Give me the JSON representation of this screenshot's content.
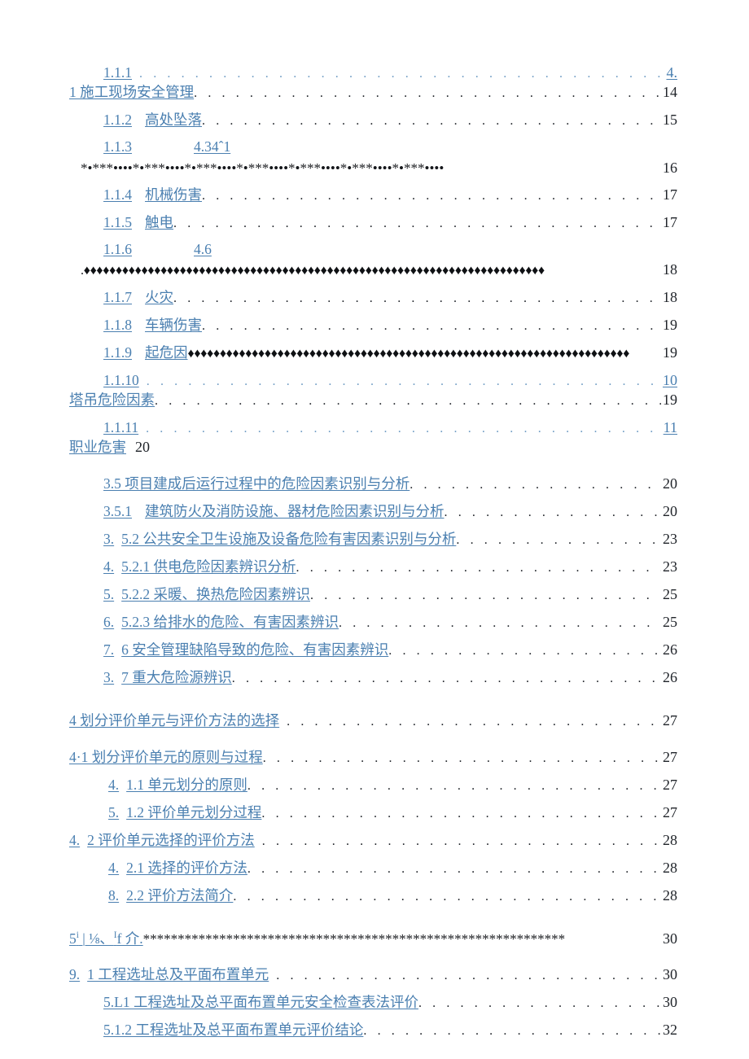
{
  "document": {
    "type": "table-of-contents",
    "language": "zh-CN",
    "page_background": "#ffffff",
    "link_color": "#4a7fb0",
    "text_color": "#20242a"
  },
  "entries": [
    {
      "id": "e1",
      "number": "1.1.1",
      "title": "",
      "page": "4.",
      "page_style": "blue",
      "leader": "dots-blue",
      "indent": 1,
      "wrap": {
        "title": "1 施工现场安全管理",
        "page": "14",
        "leader": "dots-dark",
        "page_style": "plain"
      }
    },
    {
      "id": "e2",
      "number": "1.1.2",
      "title": "高处坠落",
      "page": "15",
      "page_style": "plain",
      "leader": "dots-dark",
      "indent": 1
    },
    {
      "id": "e3",
      "number": "1.1.3",
      "title": "4.34ˆ1",
      "page": "16",
      "page_style": "plain",
      "leader": "none",
      "indent": 1,
      "sub_leader": {
        "text": "*•***••••*•***••••*•***••••*•***••••*•***••••*•***••••*•***••••",
        "page": "16"
      }
    },
    {
      "id": "e4",
      "number": "1.1.4",
      "title": "机械伤害",
      "page": "17",
      "page_style": "plain",
      "leader": "dots-dark",
      "indent": 1
    },
    {
      "id": "e5",
      "number": "1.1.5",
      "title": "触电",
      "page": "17",
      "page_style": "plain",
      "leader": "dots-dark",
      "indent": 1
    },
    {
      "id": "e6",
      "number": "1.1.6",
      "title": "4.6",
      "page": "18",
      "page_style": "plain",
      "leader": "none",
      "indent": 1,
      "sub_leader": {
        "text": ".♦♦♦♦♦♦♦♦♦♦♦♦♦♦♦♦♦♦♦♦♦♦♦♦♦♦♦♦♦♦♦♦♦♦♦♦♦♦♦♦♦♦♦♦♦♦♦♦♦♦♦♦♦♦♦♦♦♦♦♦♦♦♦♦♦♦♦♦♦♦♦♦",
        "page": "18"
      }
    },
    {
      "id": "e7",
      "number": "1.1.7",
      "title": "火灾",
      "page": "18",
      "page_style": "plain",
      "leader": "dots-dark",
      "indent": 1
    },
    {
      "id": "e8",
      "number": "1.1.8",
      "title": "车辆伤害",
      "page": "19",
      "page_style": "plain",
      "leader": "dots-dark",
      "indent": 1
    },
    {
      "id": "e9",
      "number": "1.1.9",
      "title": "起危因",
      "page": "19",
      "page_style": "plain",
      "leader": "diamonds",
      "indent": 1
    },
    {
      "id": "e10",
      "number": "1.1.10",
      "title": "",
      "page": "10",
      "page_style": "blue",
      "leader": "dots-blue",
      "indent": 1,
      "wrap": {
        "title": "塔吊危险因素",
        "page": "19",
        "leader": "dots-dark",
        "page_style": "plain"
      }
    },
    {
      "id": "e11",
      "number": "1.1.11",
      "title": "",
      "page": "11",
      "page_style": "blue",
      "leader": "dots-blue",
      "indent": 1,
      "wrap": {
        "title": "职业危害",
        "page": "20",
        "leader": "none",
        "page_style": "plain"
      }
    },
    {
      "id": "e12",
      "number": "",
      "title": "3.5 项目建成后运行过程中的危险因素识别与分析",
      "page": "20",
      "page_style": "plain",
      "leader": "dots-dark",
      "indent": 1
    },
    {
      "id": "e13",
      "number": "3.5.1",
      "title": "建筑防火及消防设施、器材危险因素识别与分析",
      "page": "20",
      "page_style": "plain",
      "leader": "dots-dark",
      "indent": 1
    },
    {
      "id": "e14",
      "number": "3.",
      "title": "5.2 公共安全卫生设施及设备危险有害因素识别与分析",
      "page": "23",
      "page_style": "plain",
      "leader": "dots-dark",
      "indent": 1
    },
    {
      "id": "e15",
      "number": "4.",
      "title": "5.2.1 供电危险因素辨识分析",
      "page": "23",
      "page_style": "plain",
      "leader": "dots-dark",
      "indent": 1
    },
    {
      "id": "e16",
      "number": "5.",
      "title": "5.2.2 采暖、换热危险因素辨识",
      "page": "25",
      "page_style": "plain",
      "leader": "dots-dark",
      "indent": 1
    },
    {
      "id": "e17",
      "number": "6.",
      "title": "5.2.3 给排水的危险、有害因素辨识",
      "page": "25",
      "page_style": "plain",
      "leader": "dots-dark",
      "indent": 1
    },
    {
      "id": "e18",
      "number": "7.",
      "title": "6 安全管理缺陷导致的危险、有害因素辨识",
      "page": "26",
      "page_style": "plain",
      "leader": "dots-dark",
      "indent": 1
    },
    {
      "id": "e19",
      "number": "3.",
      "title": "7 重大危险源辨识",
      "page": "26",
      "page_style": "plain",
      "leader": "dots-dark",
      "indent": 1
    },
    {
      "id": "e20",
      "number": "",
      "title": "4 划分评价单元与评价方法的选择",
      "page": "27",
      "page_style": "plain",
      "leader": "dots-dark",
      "indent": 0
    },
    {
      "id": "e21",
      "number": "",
      "title": "4·1 划分评价单元的原则与过程",
      "page": "27",
      "page_style": "plain",
      "leader": "dots-dark",
      "indent": 0
    },
    {
      "id": "e22",
      "number": "4.",
      "title": "1.1 单元划分的原则",
      "page": "27",
      "page_style": "plain",
      "leader": "dots-dark",
      "indent": 1
    },
    {
      "id": "e23",
      "number": "5.",
      "title": "1.2 评价单元划分过程",
      "page": "27",
      "page_style": "plain",
      "leader": "dots-dark",
      "indent": 1
    },
    {
      "id": "e24",
      "number": "4.",
      "title": "2 评价单元选择的评价方法",
      "page": "28",
      "page_style": "plain",
      "leader": "dots-dark",
      "indent": 0
    },
    {
      "id": "e25",
      "number": "4.",
      "title": "2.1 选择的评价方法",
      "page": "28",
      "page_style": "plain",
      "leader": "dots-dark",
      "indent": 1
    },
    {
      "id": "e26",
      "number": "8.",
      "title": "2.2 评价方法简介",
      "page": "28",
      "page_style": "plain",
      "leader": "dots-dark",
      "indent": 1
    },
    {
      "id": "e27",
      "number": "",
      "title": "5ⁱ | ⅛、ᶦf 介.",
      "page": "30",
      "page_style": "plain",
      "leader": "stars",
      "indent": 0,
      "garbled": true,
      "garble_parts": {
        "lead": "5",
        "sup1": "i",
        "mid": " | ⅛、",
        "sup2": "I",
        "tail": "f 介."
      }
    },
    {
      "id": "e28",
      "number": "9.",
      "title": "1 工程选址总及平面布置单元",
      "page": "30",
      "page_style": "plain",
      "leader": "dots-dark",
      "indent": 0
    },
    {
      "id": "e29",
      "number": "",
      "title": "5.L1 工程选址及总平面布置单元安全检查表法评价",
      "page": "30",
      "page_style": "plain",
      "leader": "dots-dark",
      "indent": 1
    },
    {
      "id": "e30",
      "number": "",
      "title": "5.1.2 工程选址及总平面布置单元评价结论",
      "page": "32",
      "page_style": "plain",
      "leader": "dots-dark",
      "indent": 1
    }
  ]
}
